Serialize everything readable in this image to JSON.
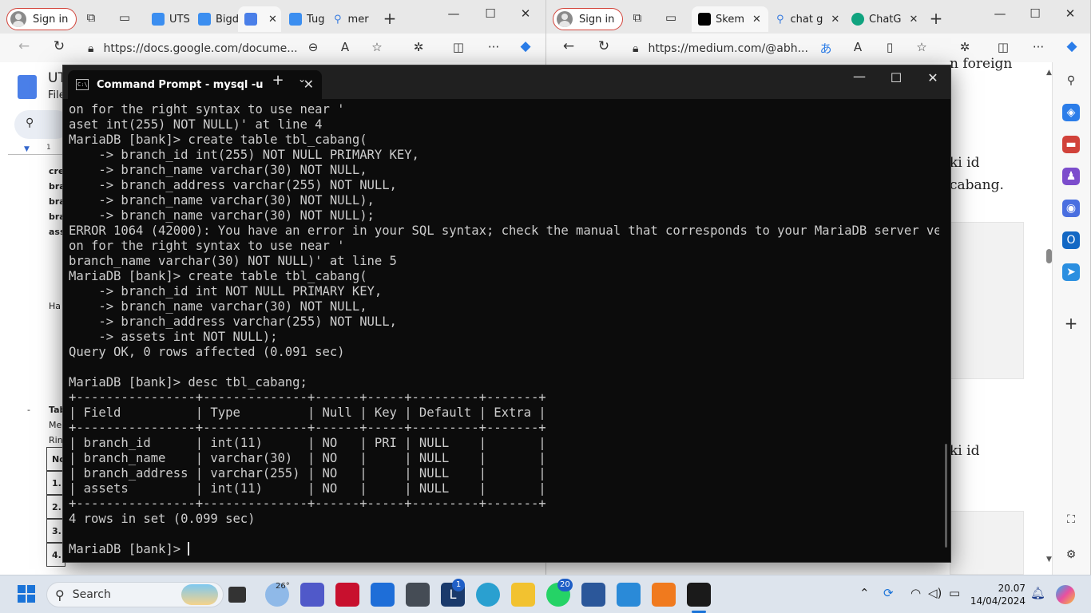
{
  "left_browser": {
    "signin_label": "Sign in",
    "tabs": [
      {
        "label": "UTS",
        "color": "#4a8af4"
      },
      {
        "label": "Bigd",
        "color": "#4a8af4"
      },
      {
        "label": "",
        "color": "#4a8af4"
      },
      {
        "label": "Tug",
        "color": "#4a8af4"
      },
      {
        "label": "mer",
        "color": "#4a8af4"
      }
    ],
    "url": "https://docs.google.com/docume...",
    "doc_title_partial": "UT",
    "doc_menu_partial": "File",
    "doc_snippets": [
      "cre",
      "bra",
      "bra",
      "bra",
      "ass",
      "Ha",
      "Tab",
      "Me",
      "Rin"
    ],
    "doc_table_cells": [
      "No",
      "1.",
      "2.",
      "3.",
      "4."
    ],
    "ruler_mark": "1"
  },
  "right_browser": {
    "signin_label": "Sign in",
    "tabs": [
      {
        "label": "Skem",
        "color": "#000000"
      },
      {
        "label": "chat g",
        "color": "#4a8af4"
      },
      {
        "label": "ChatG",
        "color": "#10a37f"
      }
    ],
    "url": "https://medium.com/@abh...",
    "page_snippets": [
      "n foreign",
      "ki id",
      "cabang.",
      "ki id"
    ]
  },
  "terminal": {
    "tab_title": "Command Prompt - mysql  -u",
    "lines": [
      "on for the right syntax to use near '",
      "aset int(255) NOT NULL)' at line 4",
      "MariaDB [bank]> create table tbl_cabang(",
      "    -> branch_id int(255) NOT NULL PRIMARY KEY,",
      "    -> branch_name varchar(30) NOT NULL,",
      "    -> branch_address varchar(255) NOT NULL,",
      "    -> branch_name varchar(30) NOT NULL),",
      "    -> branch_name varchar(30) NOT NULL);",
      "ERROR 1064 (42000): You have an error in your SQL syntax; check the manual that corresponds to your MariaDB server versi",
      "on for the right syntax to use near '",
      "branch_name varchar(30) NOT NULL)' at line 5",
      "MariaDB [bank]> create table tbl_cabang(",
      "    -> branch_id int NOT NULL PRIMARY KEY,",
      "    -> branch_name varchar(30) NOT NULL,",
      "    -> branch_address varchar(255) NOT NULL,",
      "    -> assets int NOT NULL);",
      "Query OK, 0 rows affected (0.091 sec)",
      "",
      "MariaDB [bank]> desc tbl_cabang;",
      "+----------------+--------------+------+-----+---------+-------+",
      "| Field          | Type         | Null | Key | Default | Extra |",
      "+----------------+--------------+------+-----+---------+-------+",
      "| branch_id      | int(11)      | NO   | PRI | NULL    |       |",
      "| branch_name    | varchar(30)  | NO   |     | NULL    |       |",
      "| branch_address | varchar(255) | NO   |     | NULL    |       |",
      "| assets         | int(11)      | NO   |     | NULL    |       |",
      "+----------------+--------------+------+-----+---------+-------+",
      "4 rows in set (0.099 sec)",
      "",
      "MariaDB [bank]> "
    ]
  },
  "taskbar": {
    "search_label": "Search",
    "weather_temp": "26°",
    "mail_badge": "1",
    "whatsapp_badge": "20",
    "time": "20.07",
    "date": "14/04/2024"
  }
}
